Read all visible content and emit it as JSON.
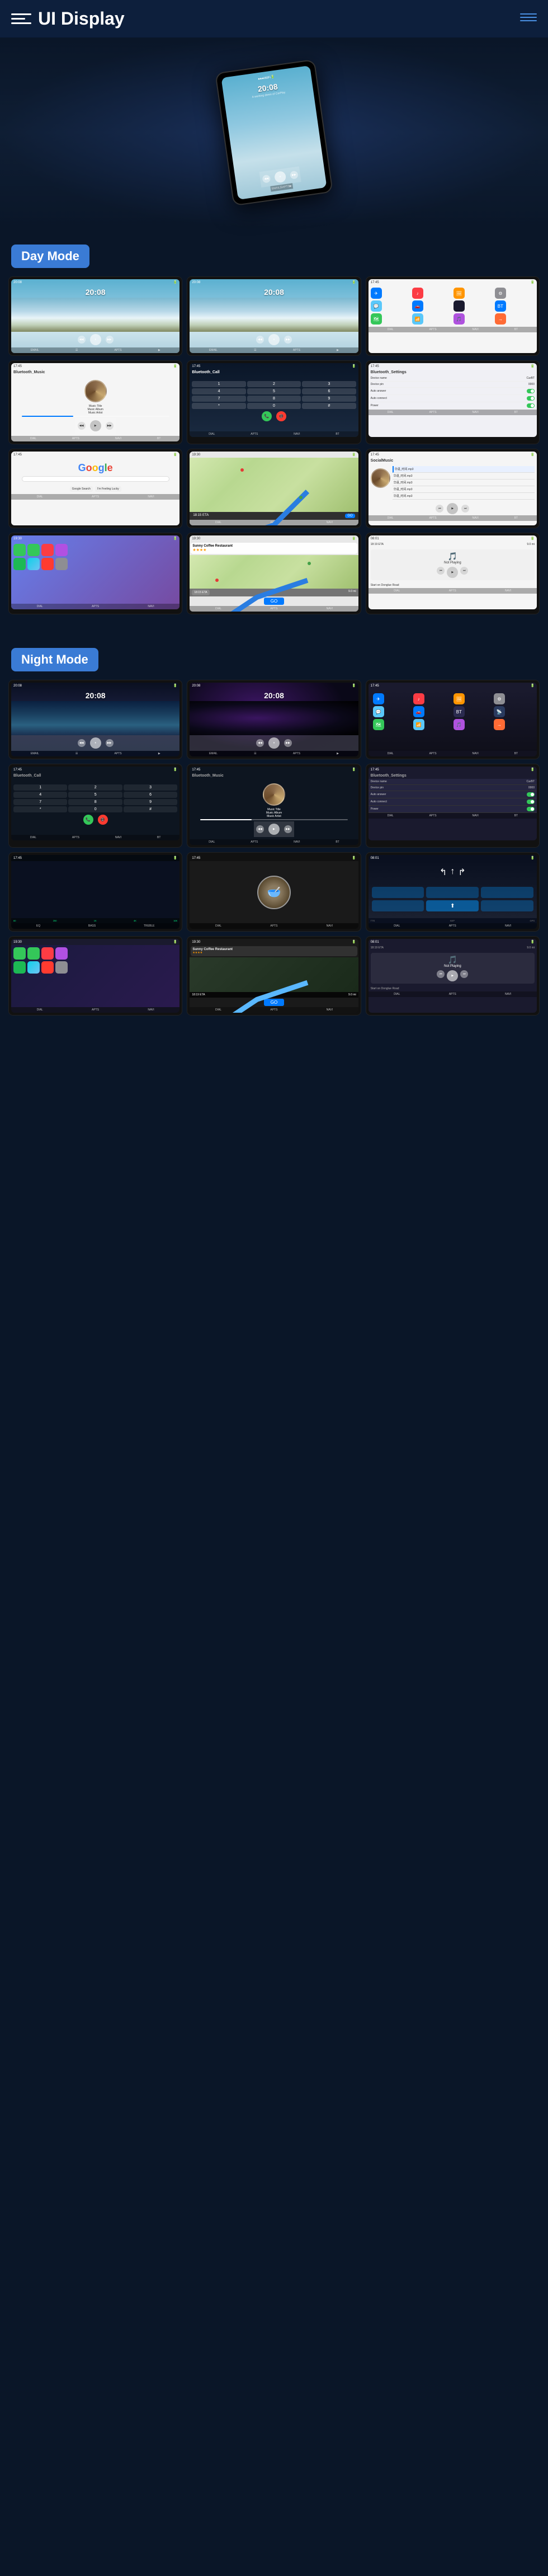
{
  "header": {
    "title": "UI Display",
    "menu_label": "menu",
    "nav_label": "navigation"
  },
  "hero": {
    "time": "20:08",
    "date": "A working demo of CarPlay"
  },
  "day_mode": {
    "label": "Day Mode",
    "screens": [
      {
        "type": "music_day_1",
        "time": "20:08",
        "subtitle": "A working demo of CarPlay"
      },
      {
        "type": "music_day_2",
        "time": "20:08",
        "subtitle": "A working demo of CarPlay"
      },
      {
        "type": "apps_day"
      },
      {
        "type": "bluetooth_music",
        "title": "Bluetooth_Music",
        "song": "Music Title",
        "album": "Music Album",
        "artist": "Music Artist"
      },
      {
        "type": "phone_call",
        "title": "Bluetooth_Call"
      },
      {
        "type": "settings",
        "title": "Bluetooth_Settings",
        "rows": [
          {
            "label": "Device name",
            "value": "CarBT"
          },
          {
            "label": "Device pin",
            "value": "0000"
          },
          {
            "label": "Auto answer",
            "toggle": true
          },
          {
            "label": "Auto connect",
            "toggle": true
          },
          {
            "label": "Power",
            "toggle": true
          }
        ]
      },
      {
        "type": "google",
        "title": "Google"
      },
      {
        "type": "navigation_map"
      },
      {
        "type": "social_music",
        "title": "SocialMusic",
        "songs": [
          "华语_时间.mp3",
          "华语_时间.mp3",
          "华语_时间.mp3",
          "华语_时间.mp3",
          "华语_时间.mp3"
        ]
      },
      {
        "type": "carplay_apps"
      },
      {
        "type": "sunny_coffee_map",
        "name": "Sunny Coffee Restaurant",
        "rating": "★★★★",
        "eta": "18:15 ETA",
        "distance": "9.0 mi"
      },
      {
        "type": "not_playing",
        "direction": "Start on Donglue Road"
      }
    ]
  },
  "night_mode": {
    "label": "Night Mode",
    "screens": [
      {
        "type": "music_night_1",
        "time": "20:08"
      },
      {
        "type": "music_night_2",
        "time": "20:08"
      },
      {
        "type": "apps_night"
      },
      {
        "type": "phone_call_night",
        "title": "Bluetooth_Call"
      },
      {
        "type": "bluetooth_music_night",
        "title": "Bluetooth_Music",
        "song": "Music Title",
        "album": "Music Album",
        "artist": "Music Artist"
      },
      {
        "type": "settings_night",
        "title": "Bluetooth_Settings"
      },
      {
        "type": "equalizer"
      },
      {
        "type": "food_screen"
      },
      {
        "type": "nav_arrows"
      },
      {
        "type": "carplay_apps_night"
      },
      {
        "type": "sunny_coffee_map_night",
        "name": "Sunny Coffee Restaurant"
      },
      {
        "type": "not_playing_night",
        "direction": "Start on Donglue Road"
      }
    ]
  }
}
